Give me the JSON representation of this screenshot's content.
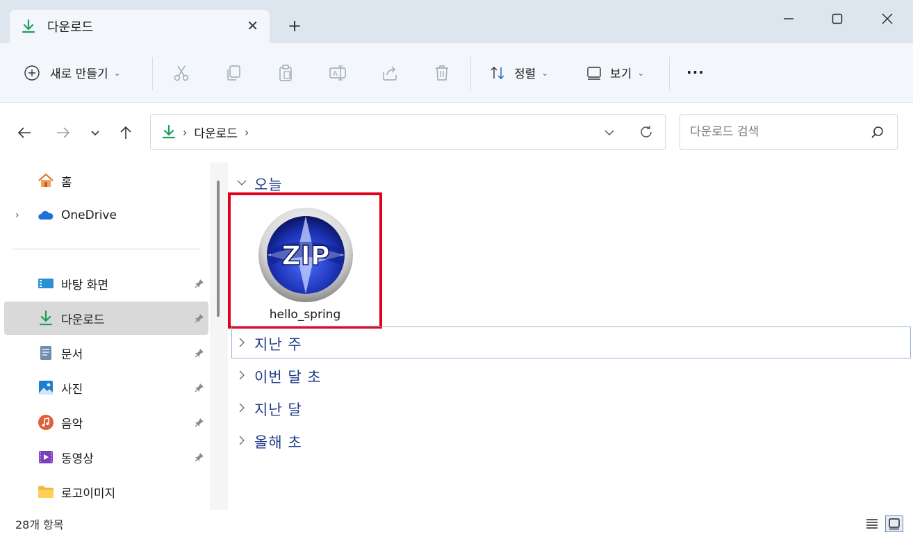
{
  "tab": {
    "title": "다운로드",
    "close_glyph": "✕",
    "new_tab_glyph": "+"
  },
  "window": {
    "minimize": "minimize-icon",
    "maximize": "maximize-icon",
    "close": "close-icon"
  },
  "toolbar": {
    "new_label": "새로 만들기",
    "sort_label": "정렬",
    "view_label": "보기",
    "more_glyph": "···",
    "icons": [
      "cut-icon",
      "copy-icon",
      "paste-icon",
      "rename-icon",
      "share-icon",
      "delete-icon"
    ]
  },
  "address": {
    "crumbs": [
      "다운로드"
    ],
    "separator": "›"
  },
  "search": {
    "placeholder": "다운로드 검색"
  },
  "sidebar": {
    "top_items": [
      {
        "label": "홈",
        "icon": "home-icon"
      },
      {
        "label": "OneDrive",
        "icon": "cloud-icon",
        "expandable": true
      }
    ],
    "pinned_items": [
      {
        "label": "바탕 화면",
        "icon": "desktop-icon"
      },
      {
        "label": "다운로드",
        "icon": "download-icon",
        "selected": true
      },
      {
        "label": "문서",
        "icon": "document-icon"
      },
      {
        "label": "사진",
        "icon": "picture-icon"
      },
      {
        "label": "음악",
        "icon": "music-icon"
      },
      {
        "label": "동영상",
        "icon": "video-icon"
      },
      {
        "label": "로고이미지",
        "icon": "folder-icon",
        "pinned": false
      }
    ]
  },
  "content": {
    "groups": [
      {
        "label": "오늘",
        "expanded": true
      },
      {
        "label": "지난 주",
        "expanded": false
      },
      {
        "label": "이번 달 초",
        "expanded": false
      },
      {
        "label": "지난 달",
        "expanded": false
      },
      {
        "label": "올해 초",
        "expanded": false
      }
    ],
    "file": {
      "name": "hello_spring",
      "icon_text": "ZIP"
    }
  },
  "status": {
    "item_count": "28개 항목"
  },
  "colors": {
    "accent": "#1f3c88",
    "highlight_box": "#e0001a",
    "download_green": "#1a9e5c"
  }
}
